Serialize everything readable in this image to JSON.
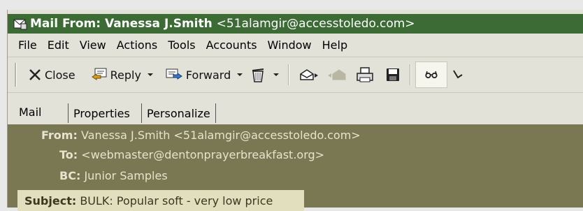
{
  "window": {
    "title_prefix": "Mail From: Vanessa J.Smith",
    "title_address": "<51alamgir@accesstoledo.com>"
  },
  "menu": [
    "File",
    "Edit",
    "View",
    "Actions",
    "Tools",
    "Accounts",
    "Window",
    "Help"
  ],
  "toolbar": {
    "close_label": "Close",
    "reply_label": "Reply",
    "forward_label": "Forward"
  },
  "tabs": {
    "mail": "Mail",
    "properties": "Properties",
    "personalize": "Personalize"
  },
  "headers": {
    "from_label": "From:",
    "from_value": "Vanessa J.Smith <51alamgir@accesstoledo.com>",
    "to_label": "To:",
    "to_value": "<webmaster@dentonprayerbreakfast.org>",
    "bc_label": "BC:",
    "bc_value": "Junior Samples",
    "subject_label": "Subject:",
    "subject_value": "BULK: Popular soft - very low price"
  },
  "colors": {
    "titlebar": "#3c6b36",
    "header_bg": "#7a7753",
    "subject_bg": "#e1dfbd"
  }
}
